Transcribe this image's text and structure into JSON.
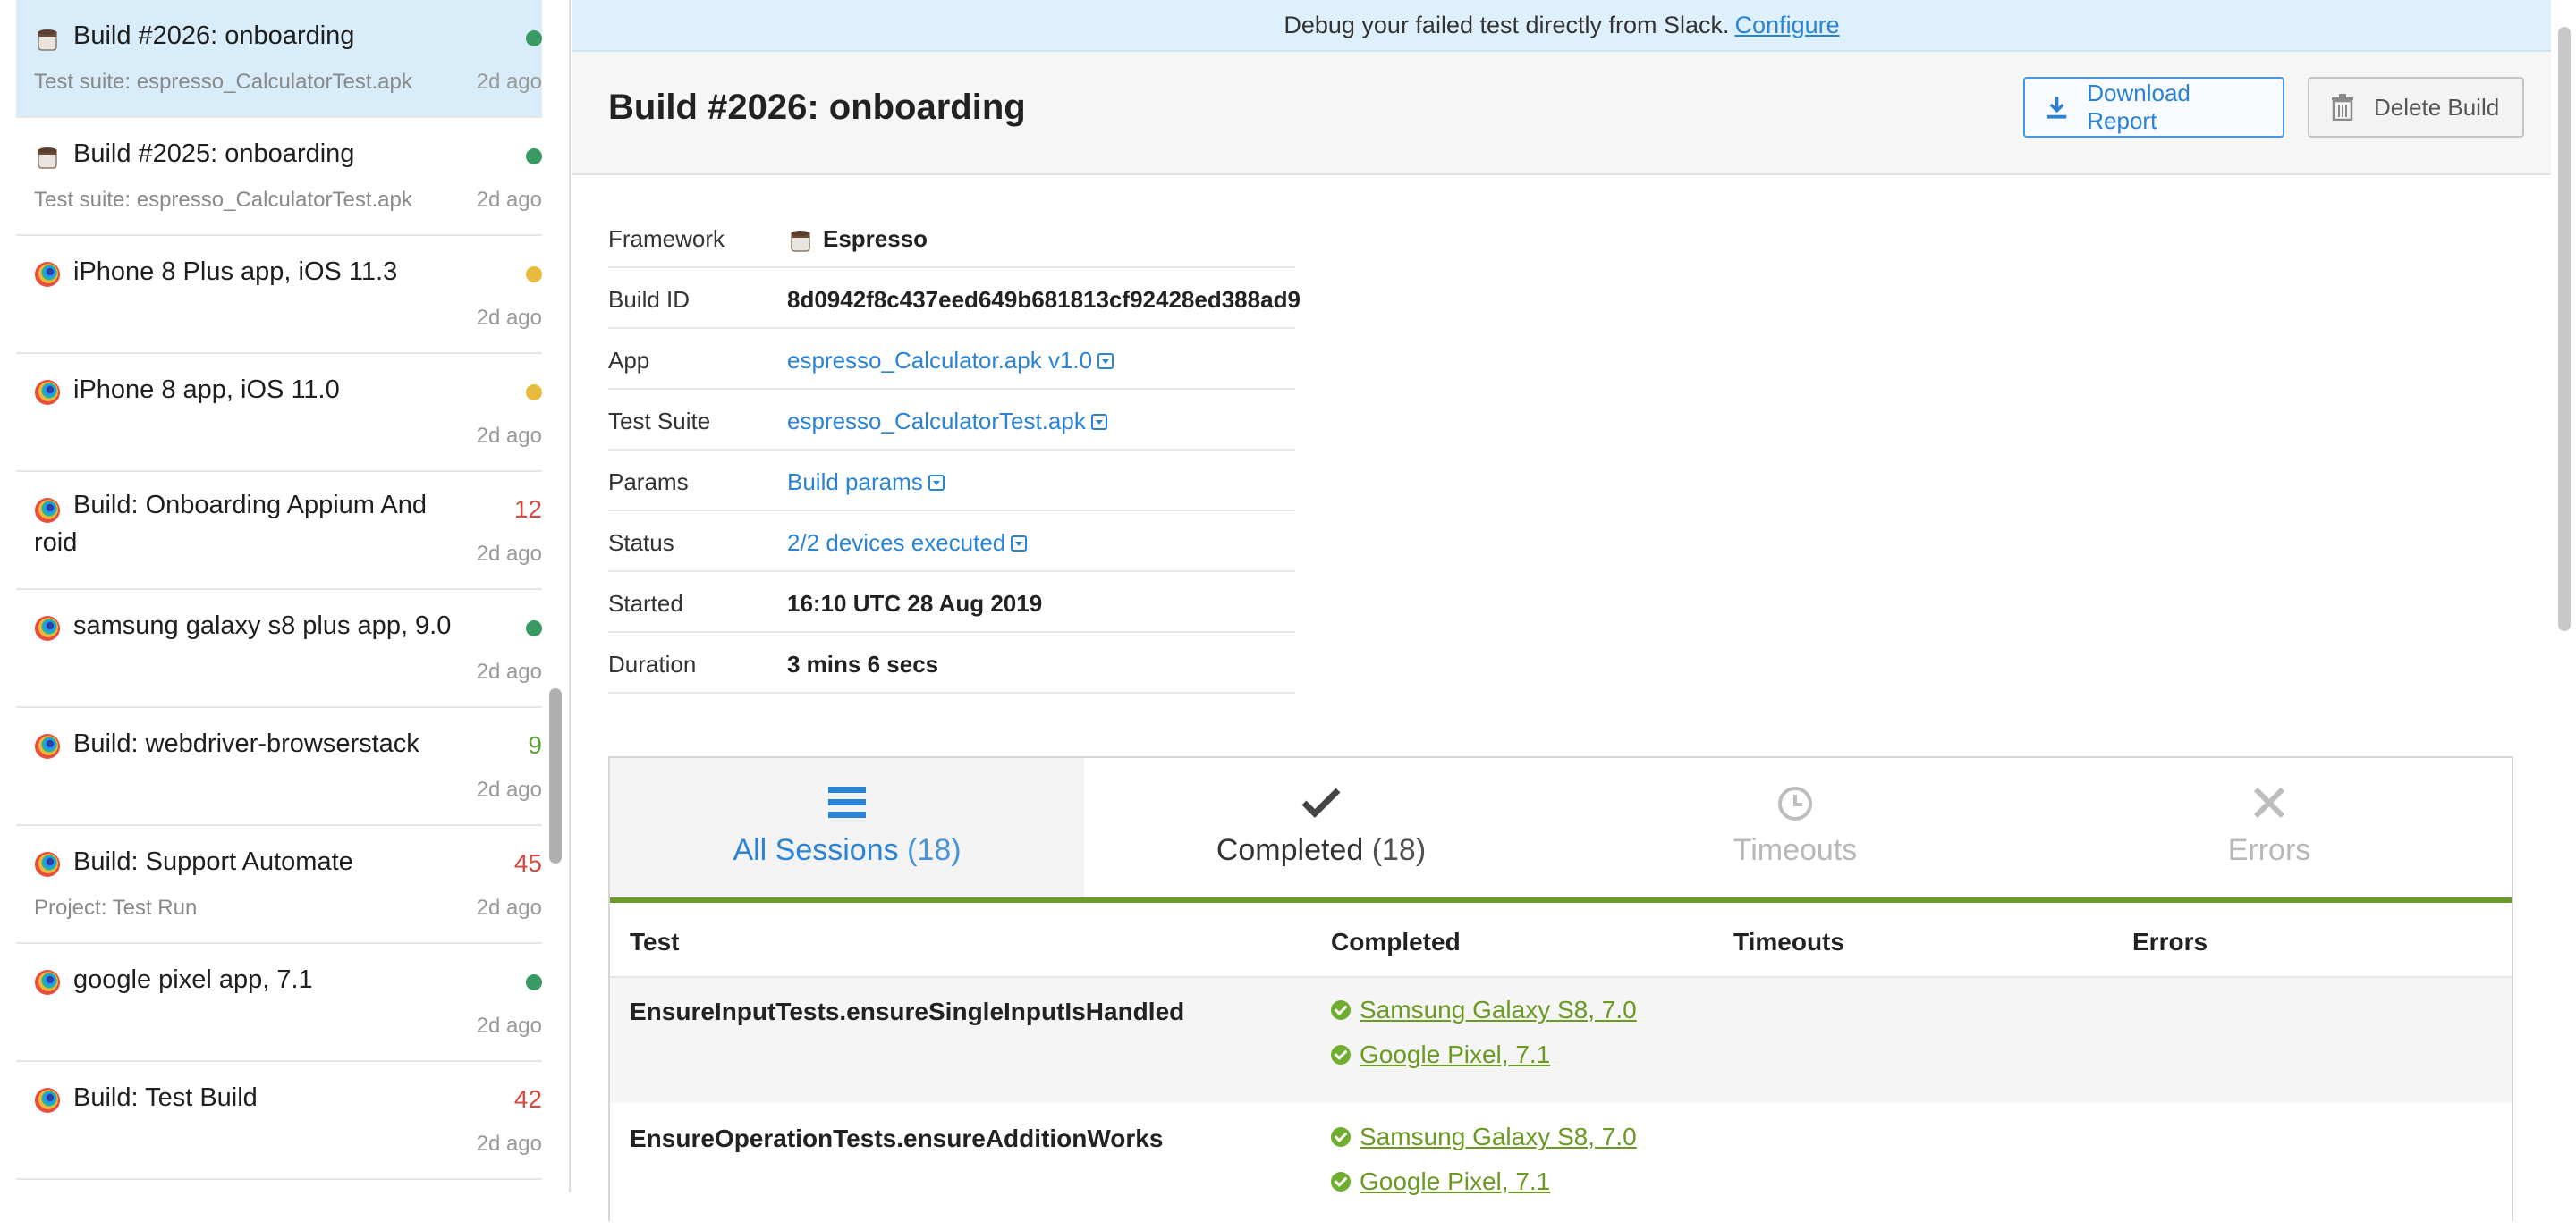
{
  "banner": {
    "text": "Debug your failed test directly from Slack.",
    "link": "Configure"
  },
  "sidebar": {
    "items": [
      {
        "title": "Build #2026: onboarding",
        "sub": "Test suite: espresso_CalculatorTest.apk",
        "ago": "2d ago",
        "icon": "espresso-icon",
        "status": "dot",
        "status_color": "#3a9a64",
        "active": true
      },
      {
        "title": "Build #2025: onboarding",
        "sub": "Test suite: espresso_CalculatorTest.apk",
        "ago": "2d ago",
        "icon": "espresso-icon",
        "status": "dot",
        "status_color": "#3a9a64"
      },
      {
        "title": "iPhone 8 Plus app, iOS 11.3",
        "sub": "",
        "ago": "2d ago",
        "icon": "browserstack-icon",
        "status": "dot",
        "status_color": "#e8bb3c"
      },
      {
        "title": "iPhone 8 app, iOS 11.0",
        "sub": "",
        "ago": "2d ago",
        "icon": "browserstack-icon",
        "status": "dot",
        "status_color": "#e8bb3c"
      },
      {
        "title": "Build: Onboarding Appium And roid",
        "sub": "",
        "ago": "2d ago",
        "icon": "browserstack-icon",
        "status": "count",
        "count": "12",
        "status_color": "#d9473e"
      },
      {
        "title": "samsung galaxy s8 plus app, 9.0",
        "sub": "",
        "ago": "2d ago",
        "icon": "browserstack-icon",
        "status": "dot",
        "status_color": "#3a9a64"
      },
      {
        "title": "Build: webdriver-browserstack",
        "sub": "",
        "ago": "2d ago",
        "icon": "browserstack-icon",
        "status": "count",
        "count": "9",
        "status_color": "#5aa02c"
      },
      {
        "title": "Build: Support Automate",
        "sub": "Project: Test Run",
        "ago": "2d ago",
        "icon": "browserstack-icon",
        "status": "count",
        "count": "45",
        "status_color": "#d9473e"
      },
      {
        "title": "google pixel app, 7.1",
        "sub": "",
        "ago": "2d ago",
        "icon": "browserstack-icon",
        "status": "dot",
        "status_color": "#3a9a64"
      },
      {
        "title": "Build: Test Build",
        "sub": "",
        "ago": "2d ago",
        "icon": "browserstack-icon",
        "status": "count",
        "count": "42",
        "status_color": "#d9473e"
      }
    ]
  },
  "header": {
    "title": "Build #2026: onboarding",
    "download_label": "Download Report",
    "delete_label": "Delete Build"
  },
  "info": {
    "framework_label": "Framework",
    "framework": "Espresso",
    "build_id_label": "Build ID",
    "build_id": "8d0942f8c437eed649b681813cf92428ed388ad9",
    "app_label": "App",
    "app": "espresso_Calculator.apk v1.0",
    "suite_label": "Test Suite",
    "suite": "espresso_CalculatorTest.apk",
    "params_label": "Params",
    "params": "Build params",
    "status_label": "Status",
    "status": "2/2 devices executed",
    "started_label": "Started",
    "started": "16:10 UTC 28 Aug 2019",
    "duration_label": "Duration",
    "duration": "3 mins 6 secs"
  },
  "tabs": {
    "all": {
      "label": "All Sessions",
      "count": "(18)"
    },
    "completed": {
      "label": "Completed",
      "count": "(18)"
    },
    "timeouts": {
      "label": "Timeouts"
    },
    "errors": {
      "label": "Errors"
    }
  },
  "table": {
    "headers": {
      "test": "Test",
      "completed": "Completed",
      "timeouts": "Timeouts",
      "errors": "Errors"
    },
    "rows": [
      {
        "test": "EnsureInputTests.ensureSingleInputIsHandled",
        "devices": [
          " Samsung Galaxy S8, 7.0",
          " Google Pixel, 7.1"
        ]
      },
      {
        "test": "EnsureOperationTests.ensureAdditionWorks",
        "devices": [
          " Samsung Galaxy S8, 7.0",
          " Google Pixel, 7.1"
        ]
      }
    ]
  },
  "colors": {
    "accent": "#2a83d4",
    "success": "#6fae2f",
    "tab_bar": "#6d9a2c"
  }
}
